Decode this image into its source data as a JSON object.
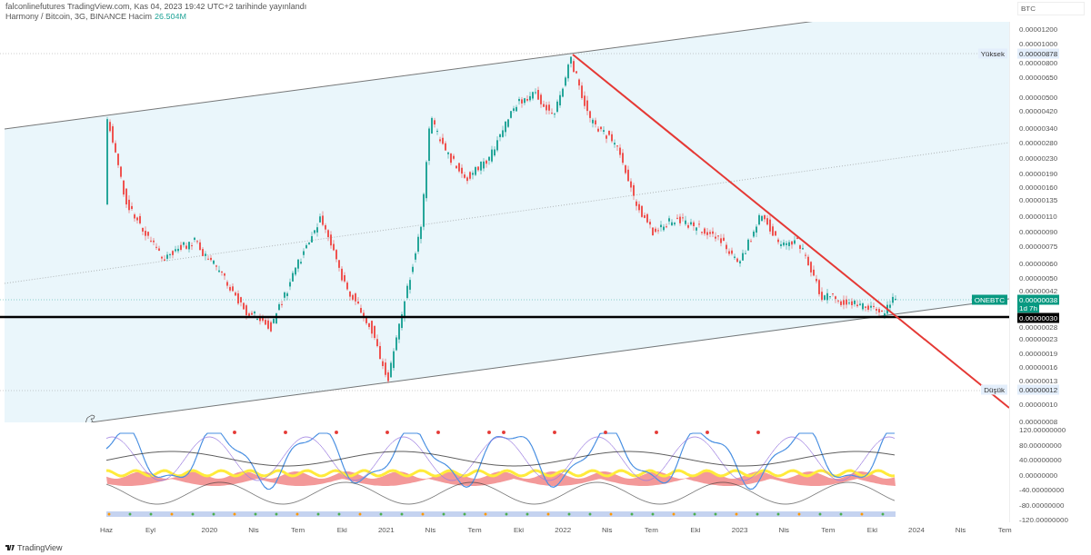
{
  "header": {
    "publisher_line": "falconlinefutures TradingView.com, Kas 04, 2023 19:42 UTC+2 tarihinde yayınlandı",
    "symbol_line": "Harmony / Bitcoin, 3G, BINANCE",
    "volume_label": "Hacim",
    "volume_value": "26.504M"
  },
  "price_axis": {
    "currency": "BTC",
    "labels": [
      "0.00001200",
      "0.00001000",
      "0.00000800",
      "0.00000650",
      "0.00000500",
      "0.00000420",
      "0.00000340",
      "0.00000280",
      "0.00000230",
      "0.00000190",
      "0.00000160",
      "0.00000135",
      "0.00000110",
      "0.00000090",
      "0.00000075",
      "0.00000060",
      "0.00000050",
      "0.00000042",
      "0.00000028",
      "0.00000023",
      "0.00000019",
      "0.00000016",
      "0.00000013",
      "0.00000010",
      "0.00000008"
    ]
  },
  "price_badges": [
    {
      "kind": "high",
      "label": "Yüksek",
      "value": "0.00000878"
    },
    {
      "kind": "symbol",
      "label": "ONEBTC",
      "value": "0.00000038",
      "countdown": "1d 7h"
    },
    {
      "kind": "line",
      "value": "0.00000030"
    },
    {
      "kind": "low",
      "label": "Düşük",
      "value": "0.00000012"
    }
  ],
  "indicator_axis": {
    "labels": [
      "120.00000000",
      "80.00000000",
      "40.00000000",
      "0.00000000",
      "-40.00000000",
      "-80.00000000",
      "-120.00000000"
    ]
  },
  "time_axis": {
    "labels": [
      "Haz",
      "Eyl",
      "2020",
      "Nis",
      "Tem",
      "Eki",
      "2021",
      "Nis",
      "Tem",
      "Eki",
      "2022",
      "Nis",
      "Tem",
      "Eki",
      "2023",
      "Nis",
      "Tem",
      "Eki",
      "2024",
      "Nis",
      "Tem"
    ]
  },
  "footer": {
    "brand": "TradingView"
  }
}
